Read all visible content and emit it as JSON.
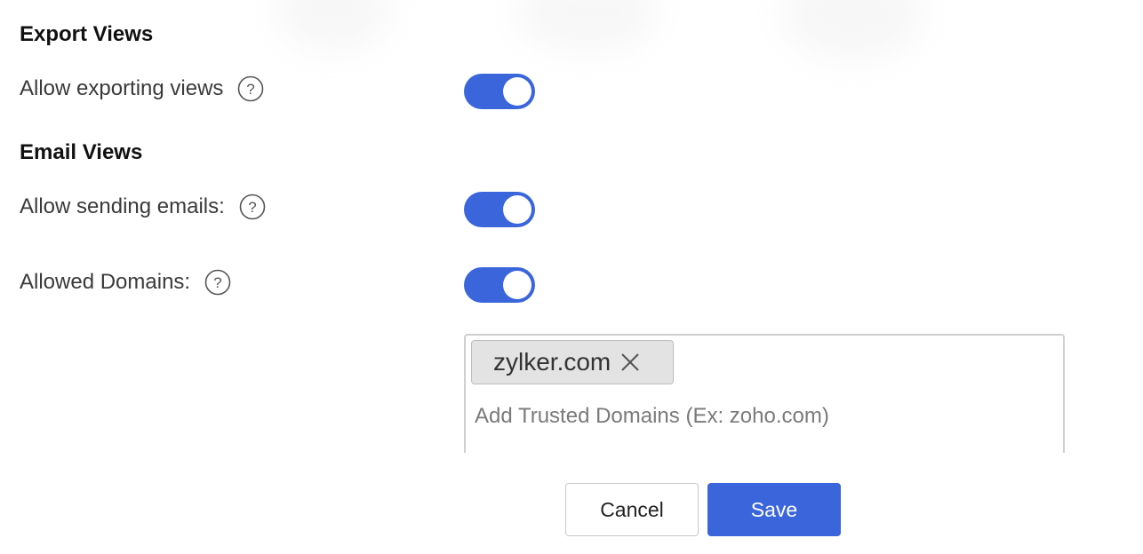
{
  "colors": {
    "accent": "#3b66db",
    "toggle_on": "#3b66db",
    "chip_bg": "#e3e3e3",
    "border": "#cfcfcf"
  },
  "export_views": {
    "title": "Export Views",
    "allow_exporting": {
      "label": "Allow exporting views",
      "help_icon": "question-circle-icon",
      "enabled": true
    }
  },
  "email_views": {
    "title": "Email Views",
    "allow_sending": {
      "label": "Allow sending emails:",
      "help_icon": "question-circle-icon",
      "enabled": true
    },
    "allowed_domains": {
      "label": "Allowed Domains:",
      "help_icon": "question-circle-icon",
      "enabled": true,
      "domains": [
        "zylker.com"
      ],
      "remove_icon": "close-icon",
      "input_value": "",
      "input_placeholder": "Add Trusted Domains (Ex: zoho.com)"
    }
  },
  "actions": {
    "cancel_label": "Cancel",
    "save_label": "Save"
  }
}
